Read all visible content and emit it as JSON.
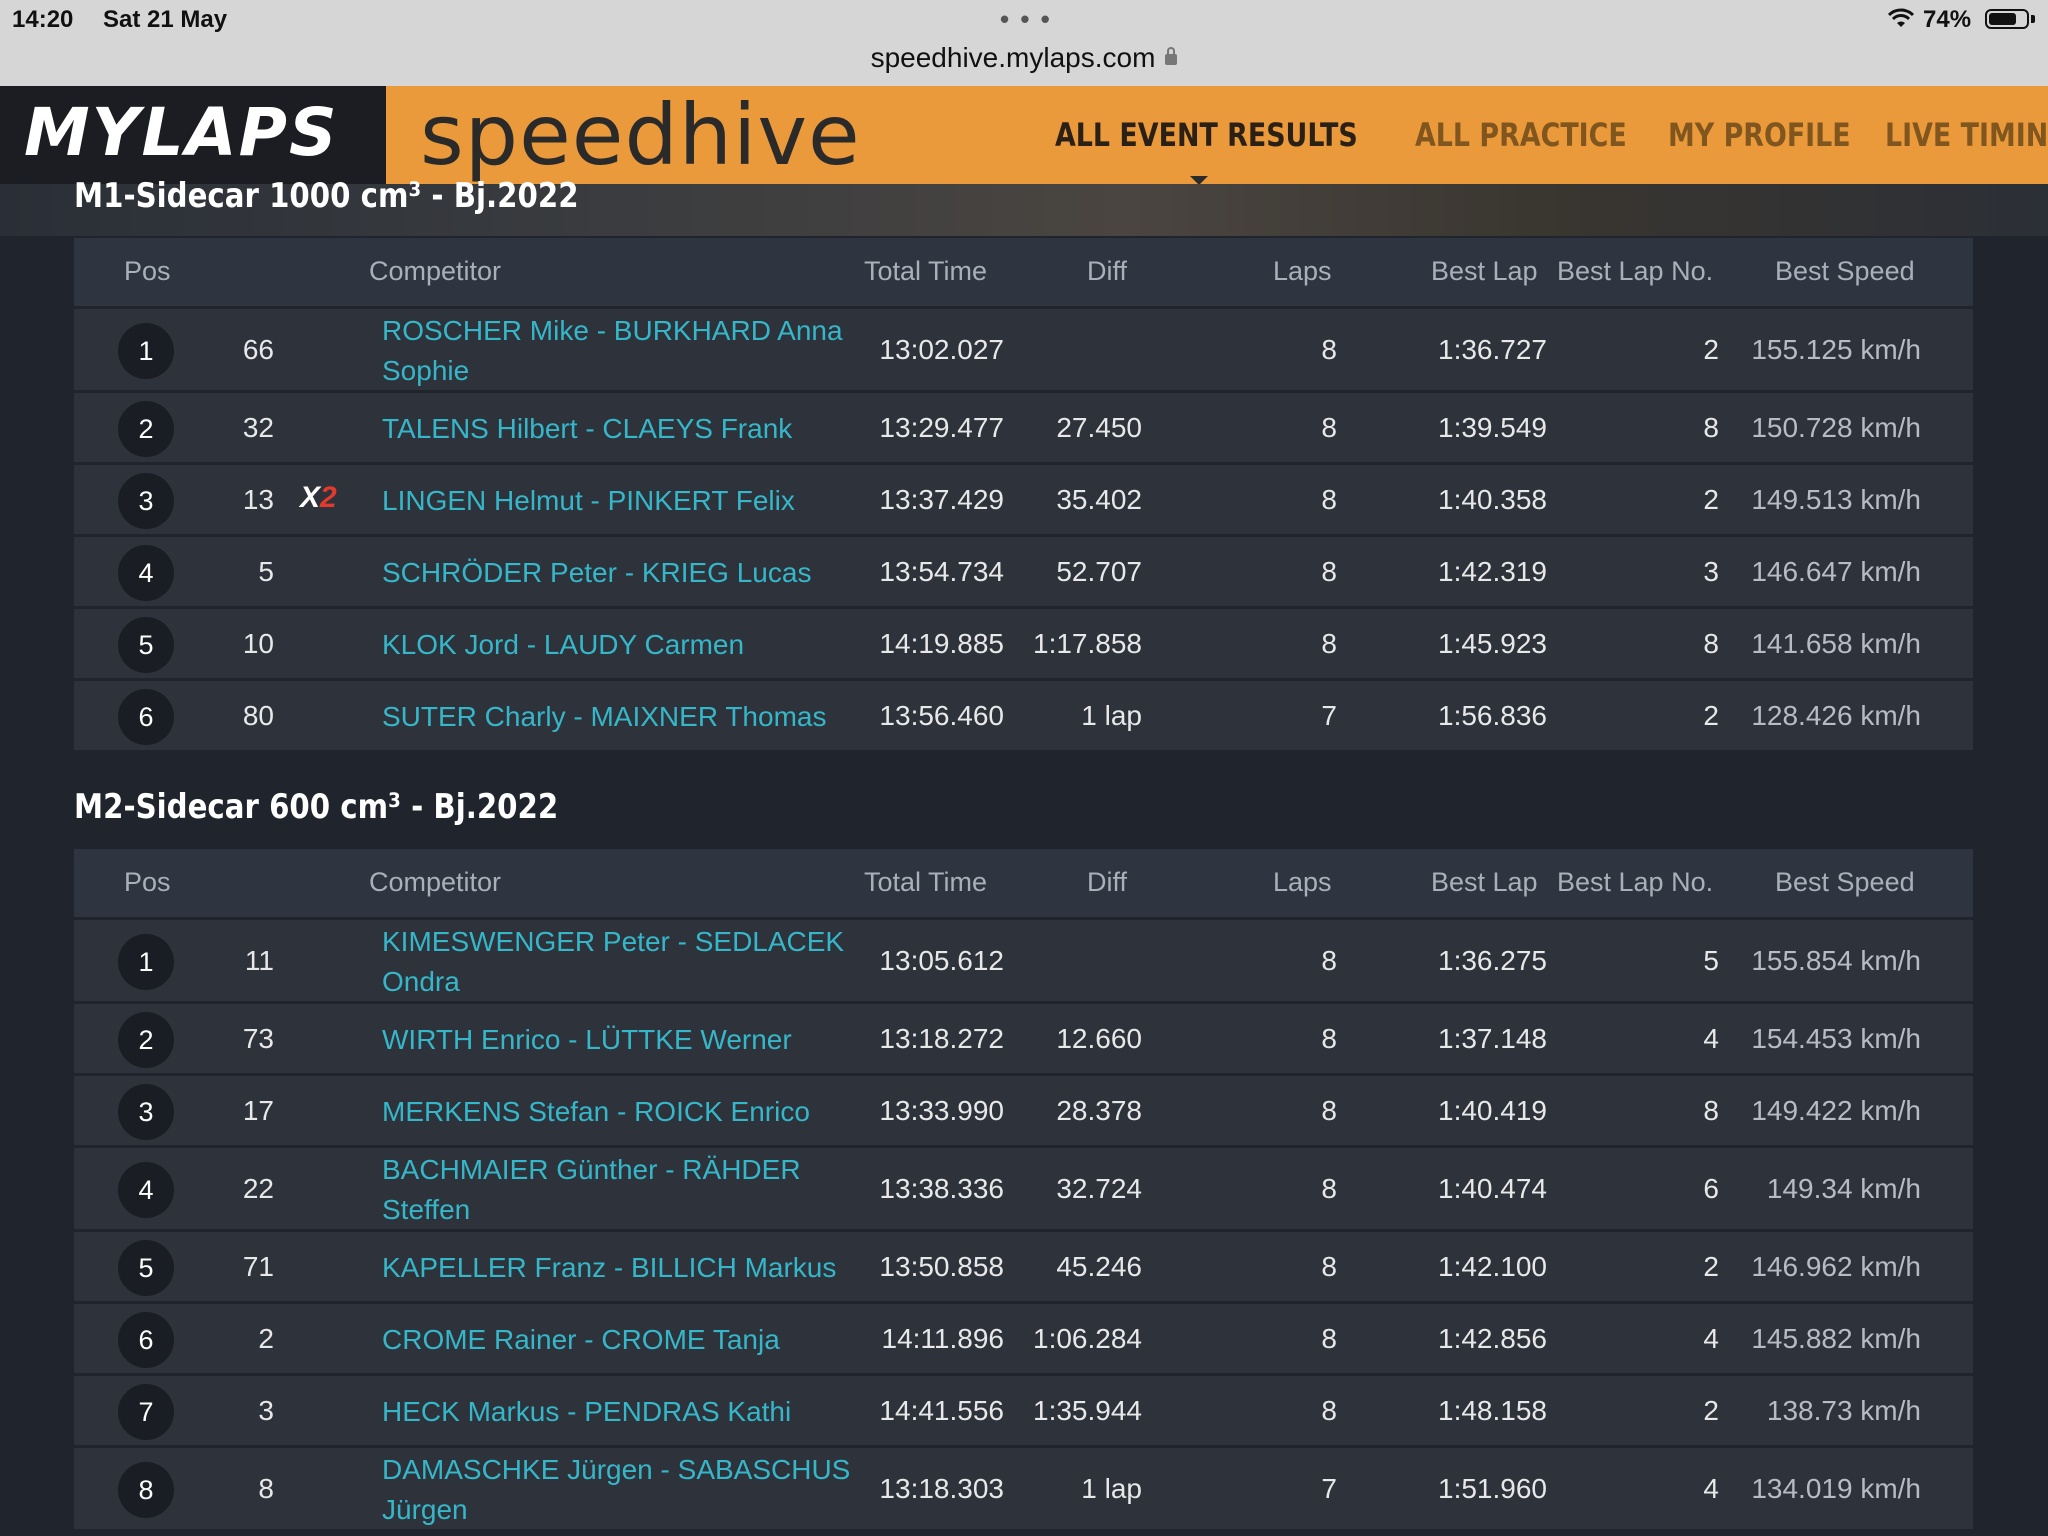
{
  "status_bar": {
    "time": "14:20",
    "date": "Sat 21 May",
    "url": "speedhive.mylaps.com",
    "battery": "74%",
    "battery_level": 0.74
  },
  "nav": {
    "logo": "MYLAPS",
    "brand": "speedhive",
    "links": [
      "ALL EVENT RESULTS",
      "ALL PRACTICE",
      "MY PROFILE",
      "LIVE TIMING"
    ],
    "active_link": "ALL EVENT RESULTS"
  },
  "columns": {
    "pos": "Pos",
    "competitor": "Competitor",
    "total_time": "Total Time",
    "diff": "Diff",
    "laps": "Laps",
    "best_lap": "Best Lap",
    "best_lap_no": "Best Lap No.",
    "best_speed": "Best Speed"
  },
  "colors": {
    "accent_orange": "#ea9a3b",
    "competitor_link": "#36b7c9",
    "badge_red": "#e23a2c"
  },
  "sections": [
    {
      "title": "M1-Sidecar 1000 cm³ - Bj.2022",
      "rows": [
        {
          "pos": "1",
          "num": "66",
          "badge": "",
          "competitor": "ROSCHER Mike - BURKHARD Anna Sophie",
          "total": "13:02.027",
          "diff": "",
          "laps": "8",
          "best_lap": "1:36.727",
          "best_lap_no": "2",
          "best_speed": "155.125 km/h"
        },
        {
          "pos": "2",
          "num": "32",
          "badge": "",
          "competitor": "TALENS Hilbert - CLAEYS Frank",
          "total": "13:29.477",
          "diff": "27.450",
          "laps": "8",
          "best_lap": "1:39.549",
          "best_lap_no": "8",
          "best_speed": "150.728 km/h"
        },
        {
          "pos": "3",
          "num": "13",
          "badge": "X2",
          "competitor": "LINGEN Helmut - PINKERT Felix",
          "total": "13:37.429",
          "diff": "35.402",
          "laps": "8",
          "best_lap": "1:40.358",
          "best_lap_no": "2",
          "best_speed": "149.513 km/h"
        },
        {
          "pos": "4",
          "num": "5",
          "badge": "",
          "competitor": "SCHRÖDER Peter - KRIEG Lucas",
          "total": "13:54.734",
          "diff": "52.707",
          "laps": "8",
          "best_lap": "1:42.319",
          "best_lap_no": "3",
          "best_speed": "146.647 km/h"
        },
        {
          "pos": "5",
          "num": "10",
          "badge": "",
          "competitor": "KLOK Jord - LAUDY Carmen",
          "total": "14:19.885",
          "diff": "1:17.858",
          "laps": "8",
          "best_lap": "1:45.923",
          "best_lap_no": "8",
          "best_speed": "141.658 km/h"
        },
        {
          "pos": "6",
          "num": "80",
          "badge": "",
          "competitor": "SUTER Charly - MAIXNER Thomas",
          "total": "13:56.460",
          "diff": "1 lap",
          "laps": "7",
          "best_lap": "1:56.836",
          "best_lap_no": "2",
          "best_speed": "128.426 km/h"
        }
      ]
    },
    {
      "title": "M2-Sidecar 600 cm³ - Bj.2022",
      "rows": [
        {
          "pos": "1",
          "num": "11",
          "badge": "",
          "competitor": "KIMESWENGER Peter - SEDLACEK Ondra",
          "total": "13:05.612",
          "diff": "",
          "laps": "8",
          "best_lap": "1:36.275",
          "best_lap_no": "5",
          "best_speed": "155.854 km/h"
        },
        {
          "pos": "2",
          "num": "73",
          "badge": "",
          "competitor": "WIRTH Enrico - LÜTTKE Werner",
          "total": "13:18.272",
          "diff": "12.660",
          "laps": "8",
          "best_lap": "1:37.148",
          "best_lap_no": "4",
          "best_speed": "154.453 km/h"
        },
        {
          "pos": "3",
          "num": "17",
          "badge": "",
          "competitor": "MERKENS Stefan - ROICK Enrico",
          "total": "13:33.990",
          "diff": "28.378",
          "laps": "8",
          "best_lap": "1:40.419",
          "best_lap_no": "8",
          "best_speed": "149.422 km/h"
        },
        {
          "pos": "4",
          "num": "22",
          "badge": "",
          "competitor": "BACHMAIER Günther - RÄHDER Steffen",
          "total": "13:38.336",
          "diff": "32.724",
          "laps": "8",
          "best_lap": "1:40.474",
          "best_lap_no": "6",
          "best_speed": "149.34 km/h"
        },
        {
          "pos": "5",
          "num": "71",
          "badge": "",
          "competitor": "KAPELLER Franz - BILLICH Markus",
          "total": "13:50.858",
          "diff": "45.246",
          "laps": "8",
          "best_lap": "1:42.100",
          "best_lap_no": "2",
          "best_speed": "146.962 km/h"
        },
        {
          "pos": "6",
          "num": "2",
          "badge": "",
          "competitor": "CROME Rainer - CROME Tanja",
          "total": "14:11.896",
          "diff": "1:06.284",
          "laps": "8",
          "best_lap": "1:42.856",
          "best_lap_no": "4",
          "best_speed": "145.882 km/h"
        },
        {
          "pos": "7",
          "num": "3",
          "badge": "",
          "competitor": "HECK Markus - PENDRAS Kathi",
          "total": "14:41.556",
          "diff": "1:35.944",
          "laps": "8",
          "best_lap": "1:48.158",
          "best_lap_no": "2",
          "best_speed": "138.73 km/h"
        },
        {
          "pos": "8",
          "num": "8",
          "badge": "",
          "competitor": "DAMASCHKE Jürgen - SABASCHUS Jürgen",
          "total": "13:18.303",
          "diff": "1 lap",
          "laps": "7",
          "best_lap": "1:51.960",
          "best_lap_no": "4",
          "best_speed": "134.019 km/h"
        }
      ]
    }
  ]
}
